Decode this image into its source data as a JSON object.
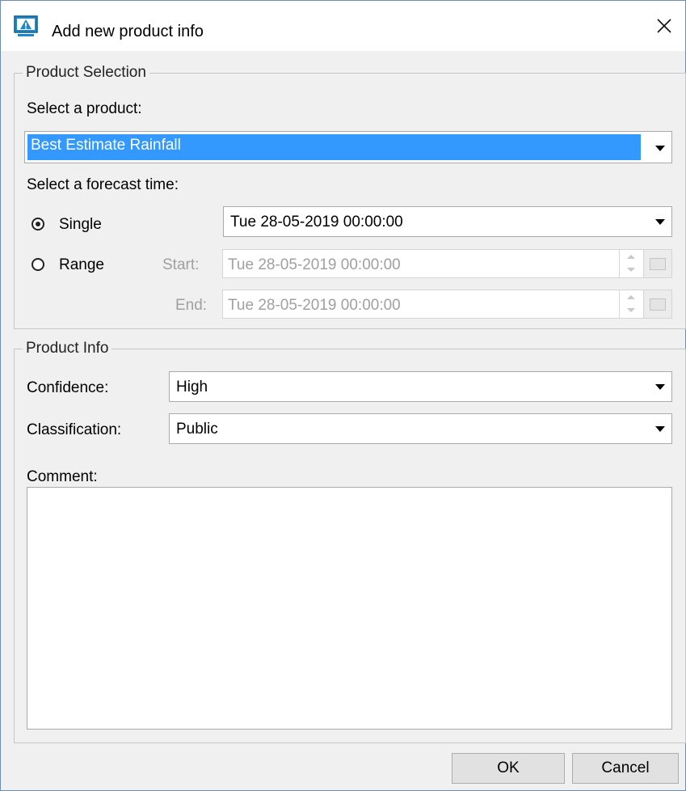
{
  "window": {
    "title": "Add new product info"
  },
  "product_selection": {
    "legend": "Product Selection",
    "select_product_label": "Select a product:",
    "product_value": "Best Estimate Rainfall",
    "select_forecast_label": "Select a forecast time:",
    "single_label": "Single",
    "single_value": "Tue 28-05-2019 00:00:00",
    "range_label": "Range",
    "start_label": "Start:",
    "start_value": "Tue 28-05-2019 00:00:00",
    "end_label": "End:",
    "end_value": "Tue 28-05-2019 00:00:00",
    "selected_mode": "Single"
  },
  "product_info": {
    "legend": "Product Info",
    "confidence_label": "Confidence:",
    "confidence_value": "High",
    "classification_label": "Classification:",
    "classification_value": "Public",
    "comment_label": "Comment:",
    "comment_value": ""
  },
  "buttons": {
    "ok": "OK",
    "cancel": "Cancel"
  },
  "colors": {
    "selection": "#3399ff",
    "border": "#6b8bb8",
    "background": "#f0f0f0"
  }
}
